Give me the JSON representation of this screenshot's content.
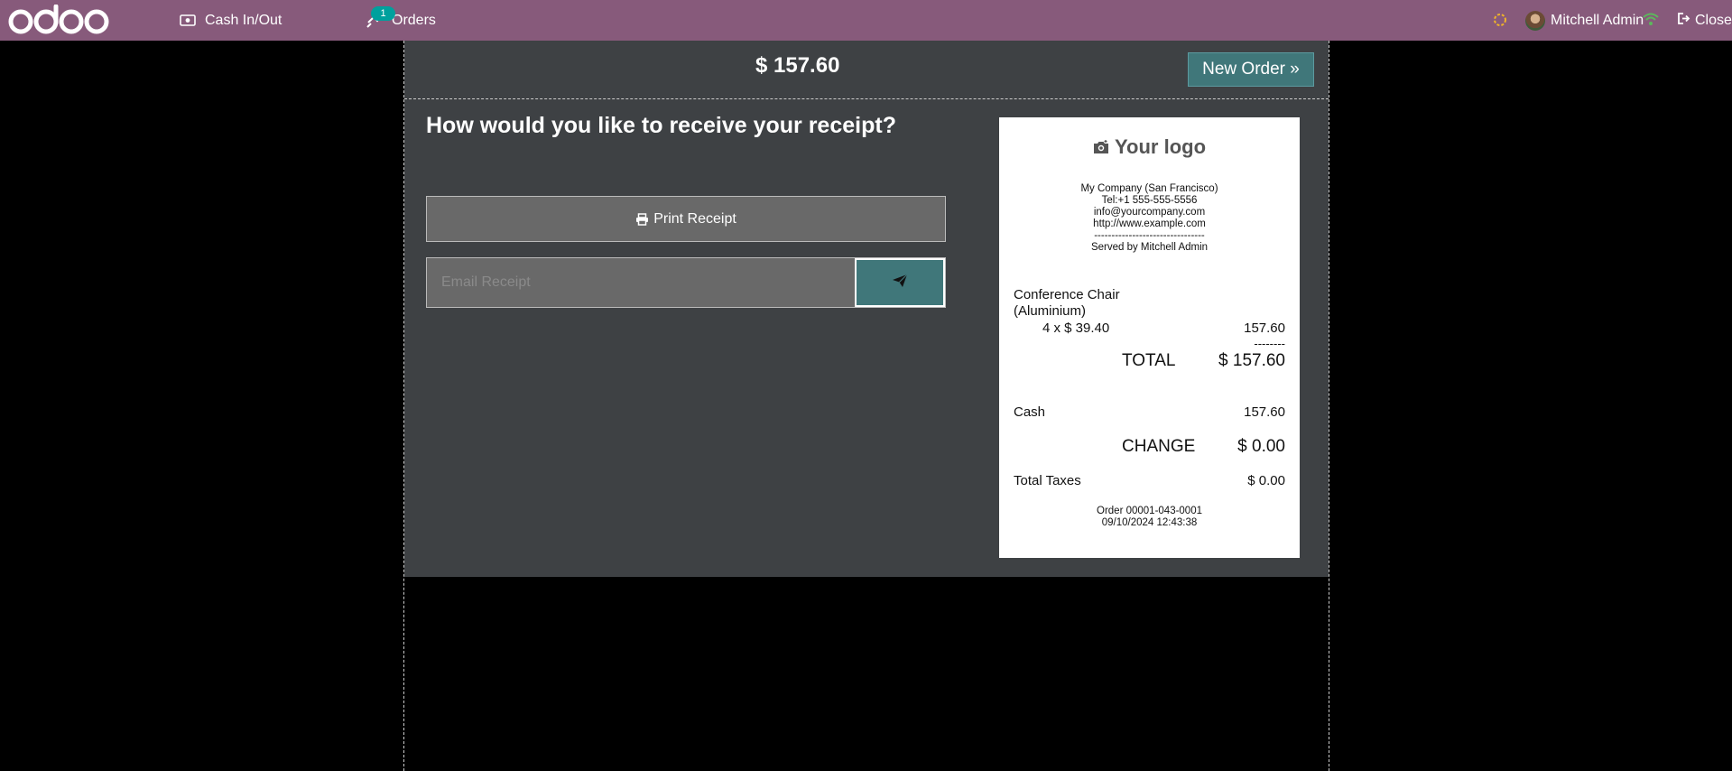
{
  "topbar": {
    "brand": "odoo",
    "cash_label": "Cash In/Out",
    "orders_label": "Orders",
    "orders_badge": "1",
    "user_name": "Mitchell Admin",
    "close_label": "Close",
    "colors": {
      "bar": "#875a7b",
      "badge": "#00a09d",
      "sync": "#f0b429",
      "wifi": "#5cb85c"
    }
  },
  "screen": {
    "total": "$ 157.60",
    "new_order_label": "New Order »",
    "question": "How would you like to receive your receipt?",
    "print_label": "Print Receipt",
    "email": {
      "placeholder": "Email Receipt",
      "value": ""
    },
    "colors": {
      "panel": "#3e4144",
      "accent": "#40777a"
    }
  },
  "receipt": {
    "logo_text": "Your logo",
    "company": "My Company (San Francisco)",
    "phone": "Tel:+1 555-555-5556",
    "email": "info@yourcompany.com",
    "website": "http://www.example.com",
    "separator": "--------------------------------",
    "served_by": "Served by Mitchell Admin",
    "lines": [
      {
        "product": "Conference Chair (Aluminium)",
        "qty_price": "4 x $ 39.40",
        "amount": "157.60"
      }
    ],
    "dashes": "--------",
    "total_label": "TOTAL",
    "total_value": "$ 157.60",
    "payment_label": "Cash",
    "payment_value": "157.60",
    "change_label": "CHANGE",
    "change_value": "$ 0.00",
    "taxes_label": "Total Taxes",
    "taxes_value": "$ 0.00",
    "order_ref": "Order 00001-043-0001",
    "order_date": "09/10/2024 12:43:38"
  }
}
